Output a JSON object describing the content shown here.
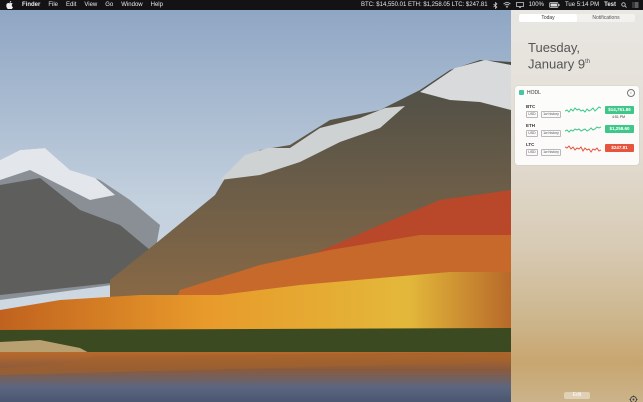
{
  "menubar": {
    "app_name": "Finder",
    "menus": [
      "File",
      "Edit",
      "View",
      "Go",
      "Window",
      "Help"
    ],
    "ticker": "BTC: $14,550.01  ETH: $1,258.05  LTC: $247.81",
    "battery": "100%",
    "clock": "Tue 5:14 PM",
    "user": "Test"
  },
  "notification_center": {
    "tabs": [
      "Today",
      "Notifications"
    ],
    "active_tab": "Today",
    "weekday": "Tuesday,",
    "month_day": "January 9",
    "day_suffix": "th",
    "widget": {
      "title": "HODL",
      "coins": [
        {
          "symbol": "BTC",
          "currency": "USD",
          "history": "1w history",
          "price": "$14,761.86",
          "time": "4:51 PM",
          "color": "#3fc78a"
        },
        {
          "symbol": "ETH",
          "currency": "USD",
          "history": "1w history",
          "price": "$1,258.60",
          "color": "#3fc78a"
        },
        {
          "symbol": "LTC",
          "currency": "USD",
          "history": "1w history",
          "price": "$247.81",
          "color": "#e5553e"
        }
      ]
    },
    "edit_label": "Edit"
  },
  "icons": [
    "apple-icon",
    "bluetooth-icon",
    "wifi-icon",
    "battery-icon",
    "display-icon",
    "search-icon",
    "notification-list-icon",
    "info-icon",
    "gear-icon"
  ]
}
